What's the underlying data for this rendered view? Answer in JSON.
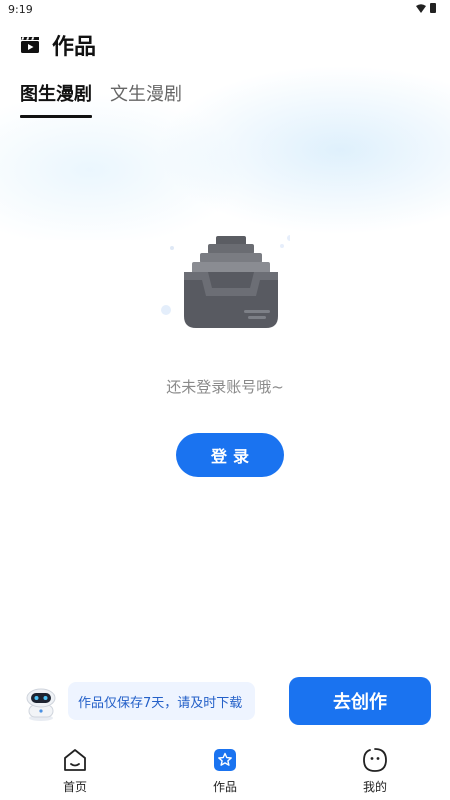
{
  "status_bar": {
    "time": "9:19"
  },
  "header": {
    "title": "作品"
  },
  "tabs": [
    {
      "label": "图生漫剧",
      "active": true
    },
    {
      "label": "文生漫剧",
      "active": false
    }
  ],
  "empty_state": {
    "message": "还未登录账号哦~",
    "login_label": "登录"
  },
  "bottom_strip": {
    "notice": "作品仅保存7天，请及时下载",
    "create_label": "去创作"
  },
  "nav": [
    {
      "label": "首页",
      "icon": "home-icon",
      "active": false
    },
    {
      "label": "作品",
      "icon": "works-icon",
      "active": true
    },
    {
      "label": "我的",
      "icon": "profile-icon",
      "active": false
    }
  ],
  "colors": {
    "accent": "#1a73f0",
    "notice_bg": "#eef4ff",
    "notice_text": "#2460c8",
    "muted_text": "#8a8a8a"
  }
}
